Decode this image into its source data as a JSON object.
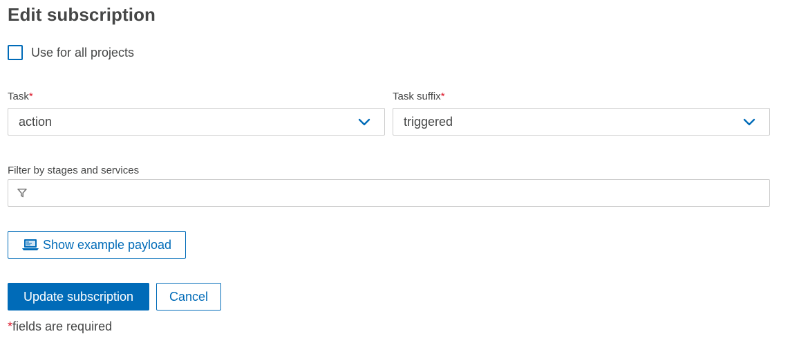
{
  "page": {
    "title": "Edit subscription"
  },
  "use_all_projects": {
    "label": "Use for all projects",
    "checked": false
  },
  "task": {
    "label": "Task",
    "required_mark": "*",
    "value": "action"
  },
  "task_suffix": {
    "label": "Task suffix",
    "required_mark": "*",
    "value": "triggered"
  },
  "filter": {
    "label": "Filter by stages and services",
    "value": "",
    "placeholder": ""
  },
  "buttons": {
    "show_payload": "Show example payload",
    "update": "Update subscription",
    "cancel": "Cancel"
  },
  "footnote": {
    "mark": "*",
    "text": "fields are required"
  },
  "icons": {
    "select_chevron": "chevron-down-icon",
    "filter": "funnel-icon",
    "payload": "laptop-icon"
  },
  "colors": {
    "accent": "#006bb8",
    "required": "#dc172a",
    "text": "#454646",
    "border": "#cccccc"
  }
}
